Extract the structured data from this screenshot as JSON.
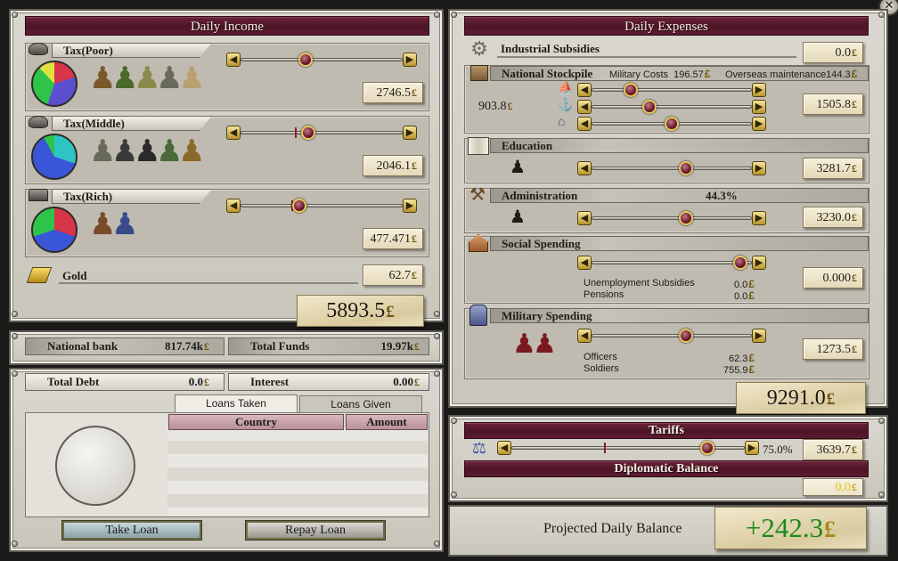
{
  "income": {
    "title": "Daily Income",
    "rows": [
      {
        "label": "Tax(Poor)",
        "value": "2746.5",
        "slider_pct": 0.39,
        "min_pct": 0.39
      },
      {
        "label": "Tax(Middle)",
        "value": "2046.1",
        "slider_pct": 0.41,
        "min_pct": 0.33
      },
      {
        "label": "Tax(Rich)",
        "value": "477.471",
        "slider_pct": 0.35,
        "min_pct": 0.31
      }
    ],
    "gold_label": "Gold",
    "gold_value": "62.7",
    "total": "5893.5"
  },
  "currency_symbol": "£",
  "bank": {
    "national_bank_label": "National bank",
    "national_bank_value": "817.74k",
    "total_funds_label": "Total Funds",
    "total_funds_value": "19.97k"
  },
  "debt": {
    "total_debt_label": "Total Debt",
    "total_debt_value": "0.0",
    "interest_label": "Interest",
    "interest_value": "0.00",
    "tabs": [
      "Loans Taken",
      "Loans Given"
    ],
    "columns": [
      "Country",
      "Amount"
    ],
    "take_loan": "Take Loan",
    "repay_loan": "Repay Loan"
  },
  "expenses": {
    "title": "Daily Expenses",
    "industrial_label": "Industrial Subsidies",
    "industrial_value": "0.0",
    "stockpile_label": "National Stockpile",
    "military_costs_label": "Military Costs",
    "military_costs_value": "196.57",
    "overseas_label": "Overseas maintenance",
    "overseas_value": "144.3",
    "stockpile_amount": "903.8",
    "stockpile_value": "1505.8",
    "stockpile_sliders": [
      0.22,
      0.35,
      0.5
    ],
    "education_label": "Education",
    "education_value": "3281.7",
    "education_pct": 0.6,
    "administration_label": "Administration",
    "administration_percent": "44.3%",
    "administration_value": "3230.0",
    "administration_pct": 0.6,
    "social_label": "Social Spending",
    "social_value": "0.000",
    "social_pct": 0.97,
    "unemployment_label": "Unemployment Subsidies",
    "unemployment_value": "0.0",
    "pensions_label": "Pensions",
    "pensions_value": "0.0",
    "military_label": "Military Spending",
    "military_value": "1273.5",
    "military_pct": 0.6,
    "officers_label": "Officers",
    "officers_value": "62.3",
    "soldiers_label": "Soldiers",
    "soldiers_value": "755.9",
    "total": "9291.0"
  },
  "tariffs": {
    "title": "Tariffs",
    "percent": "75.0%",
    "value": "3639.7",
    "pct": 0.86,
    "diplomatic_label": "Diplomatic Balance",
    "diplomatic_value": "0.0"
  },
  "projected": {
    "label": "Projected Daily Balance",
    "value": "+242.3"
  },
  "colors": {
    "banner": "#4d1426",
    "positive": "#1a8a1a",
    "diplomatic": "#e8c21a"
  },
  "icons": [
    "close-icon",
    "cap-icon",
    "bowler-hat-icon",
    "top-hat-icon",
    "gold-bars-icon",
    "gear-icon",
    "crate-icon",
    "book-icon",
    "gavel-icon",
    "house-icon",
    "soldier-icon",
    "tariff-icon"
  ]
}
